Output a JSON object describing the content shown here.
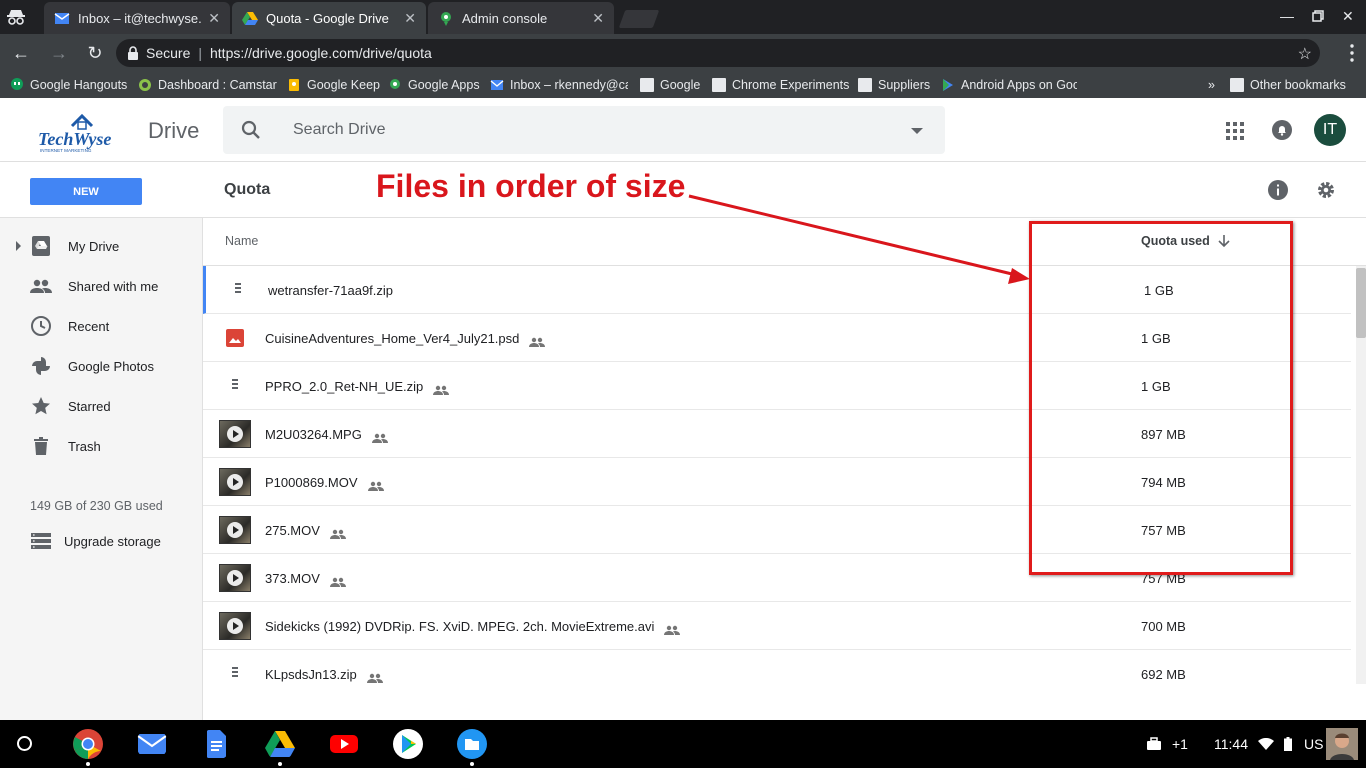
{
  "browser": {
    "tabs": [
      {
        "title": "Inbox – it@techwyse.co",
        "active": false
      },
      {
        "title": "Quota - Google Drive",
        "active": true
      },
      {
        "title": "Admin console",
        "active": false
      }
    ],
    "secure_label": "Secure",
    "url": "https://drive.google.com/drive/quota",
    "bookmarks": [
      "Google Hangouts",
      "Dashboard : Camstar",
      "Google Keep",
      "Google Apps",
      "Inbox – rkennedy@ca",
      "Google",
      "Chrome Experiments",
      "Suppliers",
      "Android Apps on Goo"
    ],
    "overflow_label": "»",
    "other_bookmarks": "Other bookmarks"
  },
  "drive": {
    "logo_text": "TechWyse",
    "logo_subtext": "INTERNET MARKETING",
    "app_name": "Drive",
    "search_placeholder": "Search Drive",
    "avatar_initials": "IT",
    "new_label": "NEW",
    "page_title": "Quota",
    "sidebar": [
      {
        "label": "My Drive",
        "icon": "drive-icon"
      },
      {
        "label": "Shared with me",
        "icon": "people-icon"
      },
      {
        "label": "Recent",
        "icon": "clock-icon"
      },
      {
        "label": "Google Photos",
        "icon": "pinwheel-icon"
      },
      {
        "label": "Starred",
        "icon": "star-icon"
      },
      {
        "label": "Trash",
        "icon": "trash-icon"
      }
    ],
    "storage_text": "149 GB of 230 GB used",
    "upgrade_label": "Upgrade storage",
    "columns": {
      "name": "Name",
      "quota": "Quota used"
    },
    "files": [
      {
        "name": "wetransfer-71aa9f.zip",
        "size": "1 GB",
        "type": "zip",
        "shared": false
      },
      {
        "name": "CuisineAdventures_Home_Ver4_July21.psd",
        "size": "1 GB",
        "type": "image",
        "shared": true
      },
      {
        "name": "PPRO_2.0_Ret-NH_UE.zip",
        "size": "1 GB",
        "type": "zip",
        "shared": true
      },
      {
        "name": "M2U03264.MPG",
        "size": "897 MB",
        "type": "video",
        "shared": true
      },
      {
        "name": "P1000869.MOV",
        "size": "794 MB",
        "type": "video",
        "shared": true
      },
      {
        "name": "275.MOV",
        "size": "757 MB",
        "type": "video",
        "shared": true
      },
      {
        "name": "373.MOV",
        "size": "757 MB",
        "type": "video",
        "shared": true
      },
      {
        "name": "Sidekicks (1992) DVDRip. FS. XviD. MPEG. 2ch. MovieExtreme.avi",
        "size": "700 MB",
        "type": "video",
        "shared": true
      },
      {
        "name": "KLpsdsJn13.zip",
        "size": "692 MB",
        "type": "zip",
        "shared": true
      }
    ]
  },
  "annotation": {
    "text": "Files in order of size",
    "color": "#d9161c"
  },
  "shelf": {
    "notification_count": "+1",
    "time": "11:44",
    "locale": "US"
  },
  "colors": {
    "accent": "#4285f4",
    "avatar_bg": "#1b4d3e"
  }
}
